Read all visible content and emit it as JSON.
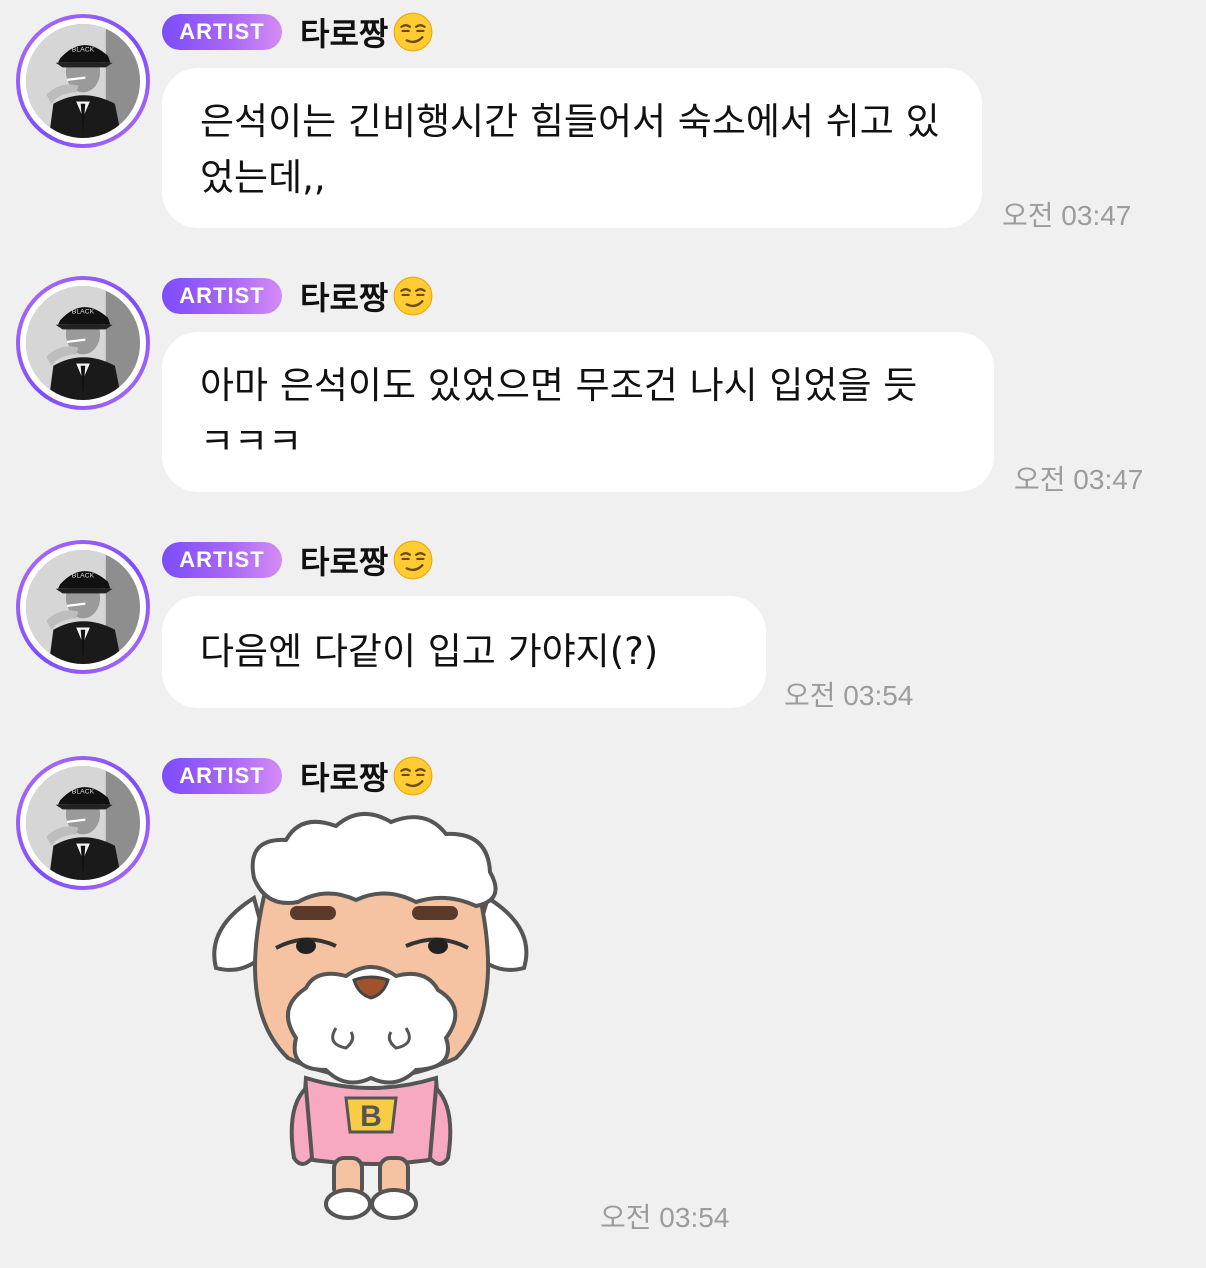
{
  "messages": [
    {
      "badge": "ARTIST",
      "sender": "타로짱",
      "emoji": "smirking-face-icon",
      "text": "은석이는 긴비행시간 힘들어서 숙소에서 쉬고 있었는데,,",
      "time": "오전 03:47"
    },
    {
      "badge": "ARTIST",
      "sender": "타로짱",
      "emoji": "smirking-face-icon",
      "text": "아마 은석이도 있었으면 무조건 나시 입었을 듯 ㅋㅋㅋ",
      "time": "오전 03:47"
    },
    {
      "badge": "ARTIST",
      "sender": "타로짱",
      "emoji": "smirking-face-icon",
      "text": "다음엔 다같이 입고 가야지(?)",
      "time": "오전 03:54"
    },
    {
      "badge": "ARTIST",
      "sender": "타로짱",
      "emoji": "smirking-face-icon",
      "sticker": "sheep-character-sticker",
      "sticker_letter": "B",
      "time": "오전 03:54"
    }
  ],
  "colors": {
    "background": "#f0f0f0",
    "bubble": "#ffffff",
    "badge_start": "#7b4dfb",
    "badge_end": "#d38cf5",
    "timestamp": "#9c9c9c"
  }
}
